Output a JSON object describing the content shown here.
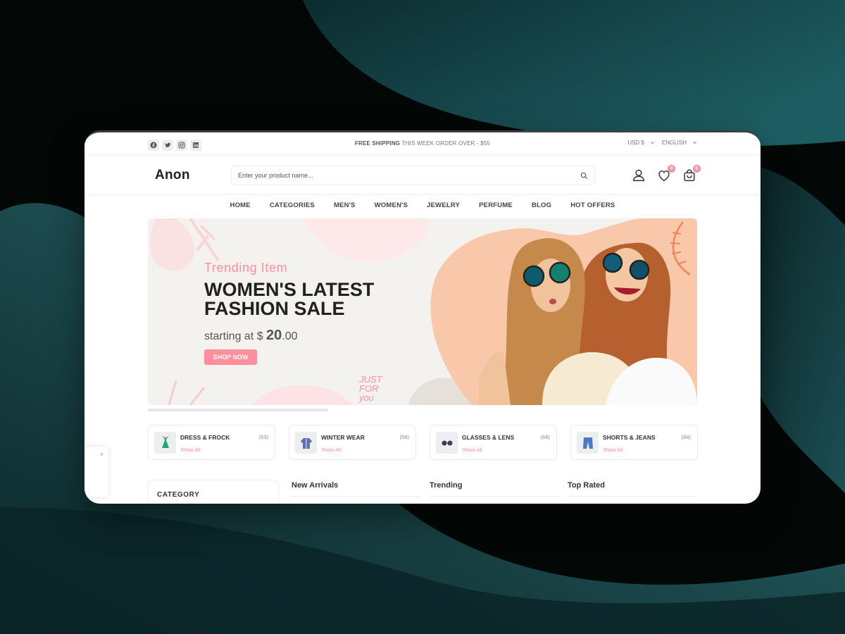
{
  "topbar": {
    "socials": [
      "facebook-icon",
      "twitter-icon",
      "instagram-icon",
      "linkedin-icon"
    ],
    "shipping_bold": "FREE SHIPPING",
    "shipping_rest": "THIS WEEK ORDER OVER - $55",
    "currency": "USD $",
    "language": "ENGLISH"
  },
  "header": {
    "logo": "Anon",
    "search_placeholder": "Enter your product name...",
    "wishlist_count": "0",
    "cart_count": "0"
  },
  "nav": [
    "HOME",
    "CATEGORIES",
    "MEN'S",
    "WOMEN'S",
    "JEWELRY",
    "PERFUME",
    "BLOG",
    "HOT OFFERS"
  ],
  "banner": {
    "subtitle": "Trending Item",
    "title": "WOMEN'S LATEST FASHION SALE",
    "price_prefix": "starting at $ ",
    "price_main": "20",
    "price_cents": ".00",
    "button": "SHOP NOW",
    "sticker": "JUST FOR you"
  },
  "categories": [
    {
      "name": "DRESS & FROCK",
      "count": "(53)",
      "link": "Show All",
      "icon": "dress-icon"
    },
    {
      "name": "WINTER WEAR",
      "count": "(58)",
      "link": "Show All",
      "icon": "jacket-icon"
    },
    {
      "name": "GLASSES & LENS",
      "count": "(68)",
      "link": "Show All",
      "icon": "glasses-icon"
    },
    {
      "name": "SHORTS & JEANS",
      "count": "(84)",
      "link": "Show All",
      "icon": "jeans-icon"
    }
  ],
  "sidebar": {
    "title": "CATEGORY"
  },
  "columns": [
    "New Arrivals",
    "Trending",
    "Top Rated"
  ],
  "colors": {
    "accent": "#ff8f9c",
    "text": "#212121",
    "teal": "#0e3c40"
  },
  "toast": {
    "close": "×"
  }
}
